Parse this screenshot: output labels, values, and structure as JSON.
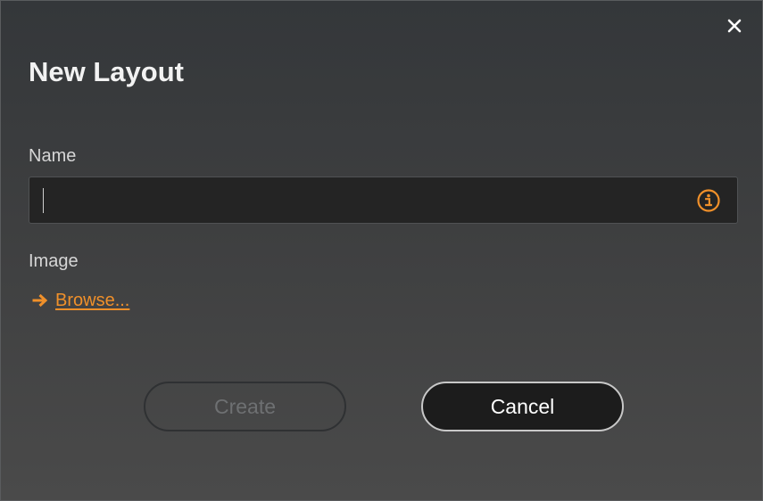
{
  "dialog": {
    "title": "New Layout",
    "close_icon": "close-icon"
  },
  "name_field": {
    "label": "Name",
    "value": "",
    "placeholder": "",
    "info_icon": "info-icon"
  },
  "image_field": {
    "label": "Image",
    "browse_label": "Browse...",
    "arrow_icon": "arrow-right-icon"
  },
  "buttons": {
    "create_label": "Create",
    "create_enabled": false,
    "cancel_label": "Cancel"
  },
  "colors": {
    "accent": "#f0902a",
    "background_top": "#34373a",
    "background_bottom": "#4a4a4a",
    "input_bg": "#242424",
    "text": "#f2f2f2"
  }
}
